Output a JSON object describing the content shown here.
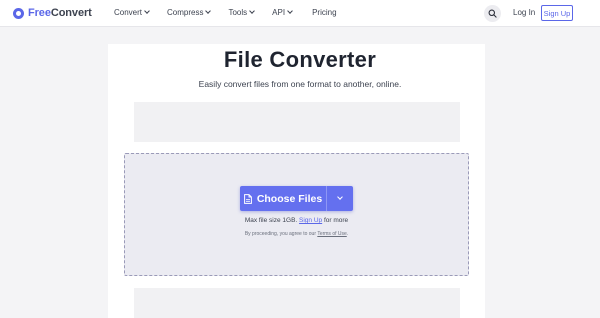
{
  "header": {
    "logo_brand": "Free",
    "logo_rest": "Convert",
    "nav": [
      {
        "label": "Convert"
      },
      {
        "label": "Compress"
      },
      {
        "label": "Tools"
      },
      {
        "label": "API"
      }
    ],
    "pricing_label": "Pricing",
    "login_label": "Log In",
    "signup_label": "Sign Up"
  },
  "main": {
    "title": "File Converter",
    "subtitle": "Easily convert files from one format to another, online.",
    "choose_label": "Choose Files",
    "max_prefix": "Max file size 1GB.",
    "max_link": "Sign Up",
    "max_suffix": "for more",
    "terms_prefix": "By proceeding, you agree to our",
    "terms_link": "Terms of Use",
    "terms_suffix": "."
  },
  "colors": {
    "accent": "#6470ef",
    "brand": "#5b67e8"
  },
  "icons": {
    "logo": "logo-icon",
    "search": "search-icon",
    "file": "file-icon",
    "dropdown": "chevron-down-icon"
  }
}
